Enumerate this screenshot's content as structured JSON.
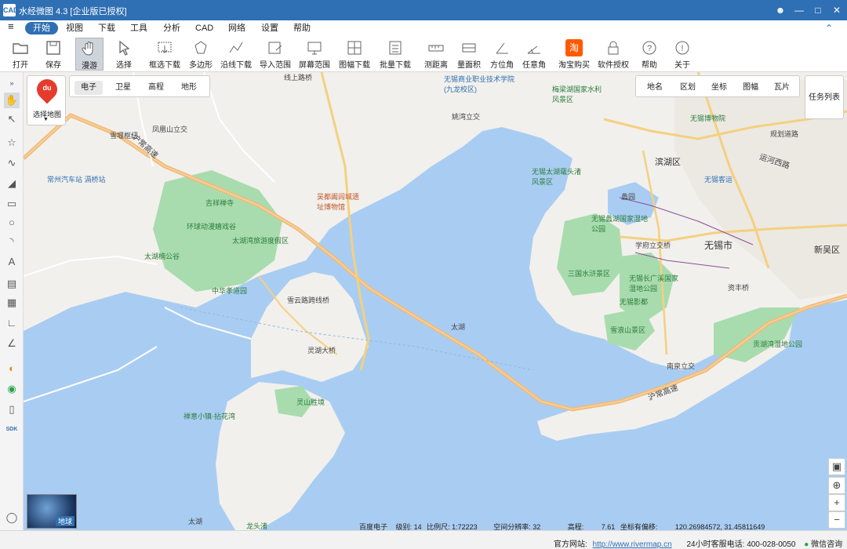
{
  "window": {
    "title": "水经微图 4.3 [企业版已授权]",
    "logo_text": "CAD"
  },
  "menu": {
    "items": [
      "开始",
      "视图",
      "下载",
      "工具",
      "分析",
      "CAD",
      "网络",
      "设置",
      "帮助"
    ]
  },
  "toolbar": {
    "items": [
      "打开",
      "保存",
      "漫游",
      "选择",
      "框选下载",
      "多边形",
      "沿线下载",
      "导入范围",
      "屏幕范围",
      "图幅下载",
      "批量下载",
      "测距离",
      "量面积",
      "方位角",
      "任意角",
      "淘宝购买",
      "软件授权",
      "帮助",
      "关于"
    ]
  },
  "map": {
    "source_button": "选择地图",
    "source_logo": "du",
    "type_tabs": [
      "电子",
      "卫星",
      "高程",
      "地形"
    ],
    "overlay_tabs": [
      "地名",
      "区划",
      "坐标",
      "图幅",
      "瓦片"
    ],
    "task_list": "任务列表",
    "globe_label": "地球",
    "labels": {
      "city": "无锡市",
      "lake": "太湖",
      "lake2": "太湖",
      "binhu": "滨湖区",
      "xinwu": "新吴区",
      "yunhe": "运河西路",
      "huchang1": "沪常高速",
      "huchang2": "沪常高速",
      "changzhou": "常州汽车站 滆桥站",
      "jixiang": "吉祥禅寺",
      "huanqiu": "环球动漫嬉戏谷",
      "taihuwan": "太湖湾旅游度假区",
      "zhonghua": "中华孝道园",
      "taihu_valley": "太湖楠公谷",
      "lingshan": "灵山胜境",
      "chanyi": "禅意小镇·拈花湾",
      "longtouzhu": "龙头渚",
      "wuxi_museum": "无锡博物院",
      "meiliang": "梅梁湖国家水利风景区",
      "yuantouzhu": "无锡太湖鼋头渚风景区",
      "lihu": "无锡蠡湖国家湿地公园",
      "sanguo": "三国水浒景区",
      "changguang": "无锡长广溪国家湿地公园",
      "yingdu": "无锡影都",
      "xuelang": "雪浪山景区",
      "gongshan": "贡湖湾湿地公园",
      "wuyue": "吴都阖闾城遗址博物馆",
      "vocational": "无锡商业职业技术学院(九龙校区)",
      "lingshu": "灵湖大桥",
      "xueyun": "雪云路跨线桥",
      "fenghuang": "凤凰山立交",
      "xueyan": "雪堰枢纽",
      "yaowan": "姚湾立交",
      "xuefu": "学府立交桥",
      "nanquan": "南泉立交",
      "zixin": "资丰桥",
      "lihu_label": "蠡园",
      "wuxi_station": "无锡客运",
      "guihua": "规划道路",
      "xianshang": "线上路桥"
    }
  },
  "status": {
    "source": "百度电子",
    "level_label": "级别:",
    "level": "14",
    "scale_label": "比例尺:",
    "scale": "1:72223",
    "resolution_label": "空间分辨率:",
    "resolution": "32",
    "elevation_label": "高程:",
    "elevation": "7.61",
    "coord_label": "坐标有偏移:",
    "coords": "120.26984572, 31.45811649",
    "website_label": "官方网站:",
    "website": "http://www.rivermap.cn",
    "hotline_label": "24小时客服电话:",
    "hotline": "400-028-0050",
    "wechat": "微信咨询"
  },
  "colors": {
    "title_bar": "#2f6fb3",
    "water": "#a9cdf2",
    "land": "#f2f0ec",
    "park": "#a8dcae",
    "highway": "#f0b97a",
    "road": "#ffffff"
  }
}
